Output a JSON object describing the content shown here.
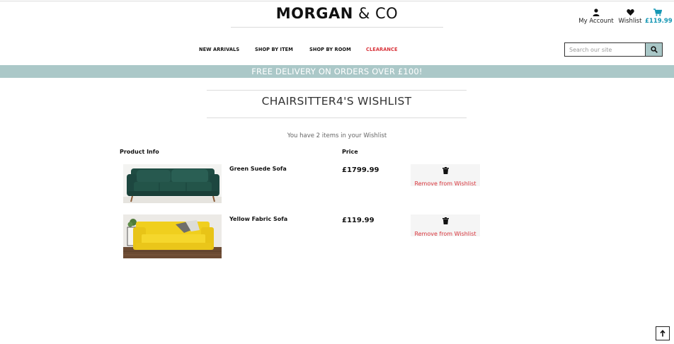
{
  "header": {
    "brand_bold": "MORGAN",
    "brand_rest": "& CO",
    "account_label": "My Account",
    "wishlist_label": "Wishlist",
    "cart_total": "£119.99",
    "icons": [
      "user-icon",
      "heart-icon",
      "cart-icon",
      "search-icon"
    ]
  },
  "nav": {
    "items": [
      "NEW ARRIVALS",
      "SHOP BY ITEM",
      "SHOP BY ROOM",
      "CLEARANCE"
    ]
  },
  "search": {
    "placeholder": "Search our site",
    "value": ""
  },
  "banner": {
    "text": "FREE DELIVERY ON ORDERS OVER £100!"
  },
  "wishlist": {
    "title": "CHAIRSITTER4'S WISHLIST",
    "count_text": "You have 2 items in your Wishlist",
    "columns": [
      "Product Info",
      "Price"
    ],
    "items": [
      {
        "name": "Green Suede Sofa",
        "price": "£1799.99",
        "action": "Remove from Wishlist"
      },
      {
        "name": "Yellow Fabric Sofa",
        "price": "£119.99",
        "action": "Remove from Wishlist"
      }
    ]
  },
  "colors": {
    "accent": "#1497b4",
    "sale": "#d9343b",
    "banner_bg": "#abc8c8"
  }
}
